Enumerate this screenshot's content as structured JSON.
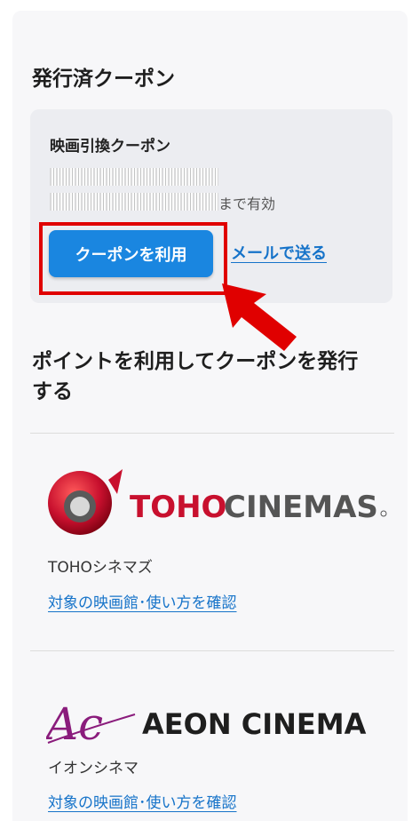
{
  "issued_section": {
    "title": "発行済クーポン",
    "coupon": {
      "name": "映画引換クーポン",
      "valid_until_suffix": "まで有効",
      "use_button": "クーポンを利用",
      "mail_link": "メールで送る"
    }
  },
  "issue_section": {
    "title_line1": "ポイントを利用してクーポンを発行",
    "title_line2": "する"
  },
  "brands": [
    {
      "logo_text": "TOHO CINEMAS",
      "name": "TOHOシネマズ",
      "link": "対象の映画館･使い方を確認"
    },
    {
      "logo_text_mark": "Ac",
      "logo_text": "AEON CINEMA",
      "name": "イオンシネマ",
      "link": "対象の映画館･使い方を確認"
    }
  ],
  "colors": {
    "primary_button": "#1a86e0",
    "link": "#1673c9",
    "highlight": "#e00000",
    "toho_red": "#c8102e",
    "aeon_purple": "#8a1c7c"
  }
}
